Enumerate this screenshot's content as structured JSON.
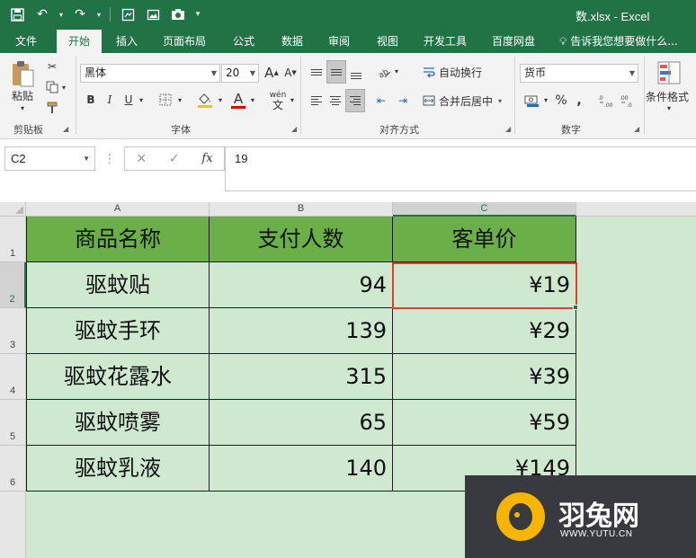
{
  "window": {
    "title": "数.xlsx  -  Excel"
  },
  "tabs": [
    "文件",
    "开始",
    "插入",
    "页面布局",
    "公式",
    "数据",
    "审阅",
    "视图",
    "开发工具",
    "百度网盘"
  ],
  "active_tab": "开始",
  "tell_me": "告诉我您想要做什么...",
  "ribbon": {
    "clipboard": {
      "paste": "粘贴",
      "label": "剪贴板"
    },
    "font": {
      "name": "黑体",
      "size": "20",
      "bold": "B",
      "italic": "I",
      "underline": "U",
      "font_color": "A",
      "wen": "wén",
      "wen_char": "文",
      "grow": "A",
      "shrink": "A",
      "label": "字体"
    },
    "alignment": {
      "wrap": "自动换行",
      "merge": "合并后居中",
      "label": "对齐方式"
    },
    "number": {
      "format": "货币",
      "percent": "%",
      "label": "数字"
    },
    "styles": {
      "cond_format": "条件格式"
    }
  },
  "formula_bar": {
    "name_box": "C2",
    "fx": "fx",
    "value": "19"
  },
  "sheet": {
    "columns": [
      "A",
      "B",
      "C"
    ],
    "rows": [
      "1",
      "2",
      "3",
      "4",
      "5",
      "6"
    ],
    "header": [
      "商品名称",
      "支付人数",
      "客单价"
    ],
    "data": [
      [
        "驱蚊贴",
        "94",
        "¥19"
      ],
      [
        "驱蚊手环",
        "139",
        "¥29"
      ],
      [
        "驱蚊花露水",
        "315",
        "¥39"
      ],
      [
        "驱蚊喷雾",
        "65",
        "¥59"
      ],
      [
        "驱蚊乳液",
        "140",
        "¥149"
      ]
    ]
  },
  "watermark": {
    "name": "羽兔网",
    "url": "WWW.YUTU.CN"
  },
  "colors": {
    "excel_green": "#217346",
    "header_fill": "#6aaf48",
    "cell_fill": "#cfe9d1",
    "selection": "#e53a2b"
  }
}
